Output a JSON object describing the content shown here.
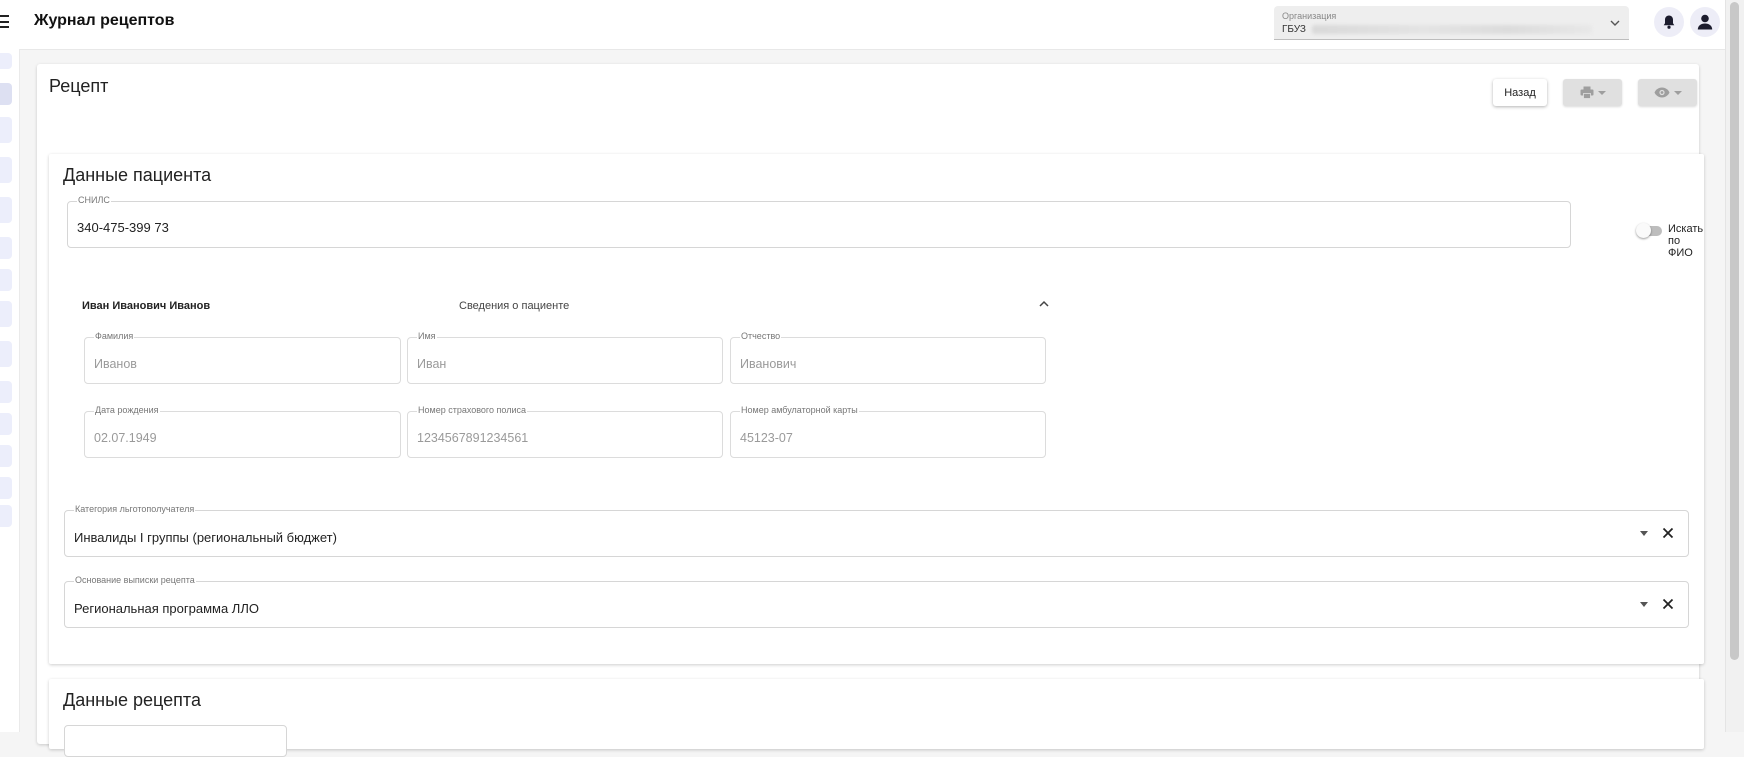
{
  "app": {
    "title": "Журнал рецептов"
  },
  "organization": {
    "label": "Организация",
    "value": "ГБУЗ"
  },
  "card": {
    "title": "Рецепт",
    "back_label": "Назад"
  },
  "patient_section": {
    "title": "Данные пациента",
    "snils": {
      "label": "СНИЛС",
      "value": "340-475-399 73"
    },
    "search_by_fio": {
      "label": "Искать по ФИО",
      "on": false
    },
    "patient_name": "Иван Иванович Иванов",
    "patient_info_link": "Сведения о пациенте",
    "fields": {
      "surname": {
        "label": "Фамилия",
        "value": "Иванов"
      },
      "name": {
        "label": "Имя",
        "value": "Иван"
      },
      "patronymic": {
        "label": "Отчество",
        "value": "Иванович"
      },
      "birth_date": {
        "label": "Дата рождения",
        "value": "02.07.1949"
      },
      "policy": {
        "label": "Номер страхового полиса",
        "value": "1234567891234561"
      },
      "card_number": {
        "label": "Номер амбулаторной карты",
        "value": "45123-07"
      }
    },
    "category": {
      "label": "Категория льготополучателя",
      "value": "Инвалиды I группы (региональный бюджет)"
    },
    "basis": {
      "label": "Основание выписки рецепта",
      "value": "Региональная программа ЛЛО"
    }
  },
  "recipe_section": {
    "title": "Данные рецепта"
  },
  "colors": {
    "accent_bg": "#ededf7",
    "rail": "#eceefb"
  }
}
